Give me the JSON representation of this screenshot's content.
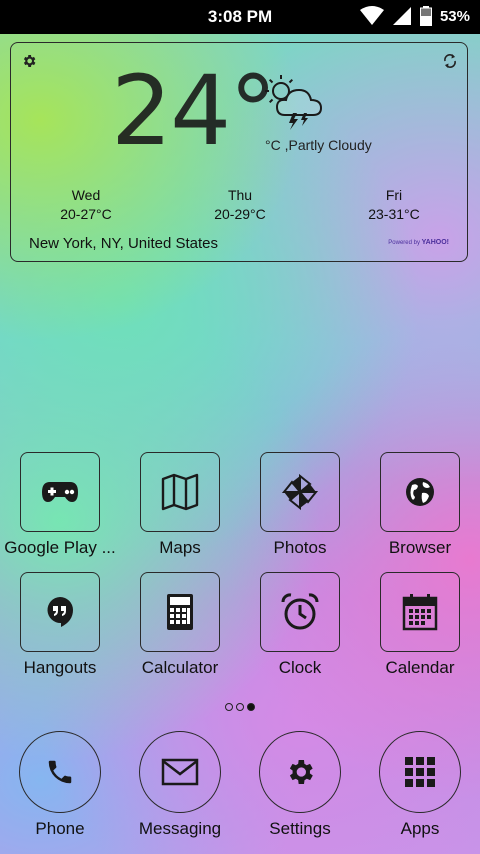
{
  "status_bar": {
    "time": "3:08 PM",
    "battery": "53%"
  },
  "weather": {
    "temperature": "24°",
    "condition": "°C ,Partly Cloudy",
    "forecast": [
      {
        "day": "Wed",
        "range": "20-27°C"
      },
      {
        "day": "Thu",
        "range": "20-29°C"
      },
      {
        "day": "Fri",
        "range": "23-31°C"
      }
    ],
    "location": "New York,  NY, United States",
    "powered_by": "Powered by",
    "brand": "YAHOO!"
  },
  "apps": [
    {
      "label": "Google Play ...",
      "icon": "gamepad-icon"
    },
    {
      "label": "Maps",
      "icon": "map-icon"
    },
    {
      "label": "Photos",
      "icon": "pinwheel-icon"
    },
    {
      "label": "Browser",
      "icon": "globe-icon"
    },
    {
      "label": "Hangouts",
      "icon": "quote-bubble-icon"
    },
    {
      "label": "Calculator",
      "icon": "calculator-icon"
    },
    {
      "label": "Clock",
      "icon": "alarm-clock-icon"
    },
    {
      "label": "Calendar",
      "icon": "calendar-icon"
    }
  ],
  "page_indicator": {
    "total": 3,
    "active": 3
  },
  "dock": [
    {
      "label": "Phone",
      "icon": "phone-icon"
    },
    {
      "label": "Messaging",
      "icon": "envelope-icon"
    },
    {
      "label": "Settings",
      "icon": "gear-icon"
    },
    {
      "label": "Apps",
      "icon": "app-grid-icon"
    }
  ]
}
